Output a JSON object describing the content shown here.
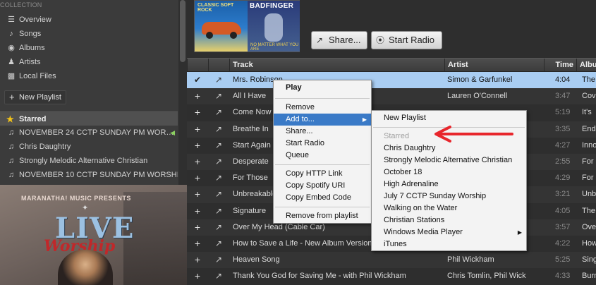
{
  "sidebar": {
    "section_title": "COLLECTION",
    "nav": [
      {
        "label": "Overview",
        "icon": "overview-icon"
      },
      {
        "label": "Songs",
        "icon": "music-note-icon"
      },
      {
        "label": "Albums",
        "icon": "album-icon"
      },
      {
        "label": "Artists",
        "icon": "artist-icon"
      },
      {
        "label": "Local Files",
        "icon": "local-files-icon"
      }
    ],
    "new_playlist": "New Playlist",
    "starred": "Starred",
    "playlists": [
      {
        "label": "NOVEMBER 24 CCTP SUNDAY PM WOR…",
        "playing": true
      },
      {
        "label": "Chris Daughtry",
        "playing": false
      },
      {
        "label": "Strongly Melodic Alternative Christian",
        "playing": false
      },
      {
        "label": "NOVEMBER 10 CCTP SUNDAY PM WORSHIP",
        "playing": false
      }
    ],
    "cover": {
      "top_text": "MARANATHA! MUSIC PRESENTS",
      "title_line1": "LIVE",
      "title_line2": "Worship"
    }
  },
  "header": {
    "album_art_1": {
      "top": "CLASSIC SOFT ROCK"
    },
    "album_art_2": {
      "top": "BADFINGER",
      "bottom": "NO MATTER WHAT YOU ARE"
    },
    "share_label": "Share...",
    "radio_label": "Start Radio"
  },
  "table": {
    "columns": {
      "track": "Track",
      "artist": "Artist",
      "time": "Time",
      "album": "Albu"
    },
    "rows": [
      {
        "track": "Mrs. Robinson",
        "artist": "Simon & Garfunkel",
        "time": "4:04",
        "album": "The",
        "selected": true
      },
      {
        "track": "All I Have",
        "artist": "Lauren O'Connell",
        "time": "3:47",
        "album": "Cov"
      },
      {
        "track": "Come Now",
        "artist": "",
        "time": "5:19",
        "album": "It's"
      },
      {
        "track": "Breathe In",
        "artist": "",
        "time": "3:35",
        "album": "End"
      },
      {
        "track": "Start Again",
        "artist": "",
        "time": "4:27",
        "album": "Inno"
      },
      {
        "track": "Desperate",
        "artist": "",
        "time": "2:55",
        "album": "For"
      },
      {
        "track": "For Those",
        "artist": "",
        "time": "4:29",
        "album": "For"
      },
      {
        "track": "Unbreakable",
        "artist": "",
        "time": "3:21",
        "album": "Unb"
      },
      {
        "track": "Signature",
        "artist": "",
        "time": "4:05",
        "album": "The"
      },
      {
        "track": "Over My Head (Cable Car)",
        "artist": "",
        "time": "3:57",
        "album": "Ove"
      },
      {
        "track": "How to Save a Life - New Album Version",
        "artist": "The Fray",
        "time": "4:22",
        "album": "How"
      },
      {
        "track": "Heaven Song",
        "artist": "Phil Wickham",
        "time": "5:25",
        "album": "Sing"
      },
      {
        "track": "Thank You God for Saving Me - with Phil Wickham",
        "artist": "Chris Tomlin, Phil Wick",
        "time": "4:33",
        "album": "Burn"
      }
    ]
  },
  "context_menu": {
    "play": "Play",
    "remove": "Remove",
    "add_to": "Add to...",
    "share": "Share...",
    "start_radio": "Start Radio",
    "queue": "Queue",
    "copy_http": "Copy HTTP Link",
    "copy_uri": "Copy Spotify URI",
    "copy_embed": "Copy Embed Code",
    "remove_from_playlist": "Remove from playlist"
  },
  "submenu": {
    "new_playlist": "New Playlist",
    "items": [
      {
        "label": "Starred",
        "disabled": true
      },
      {
        "label": "Chris Daughtry"
      },
      {
        "label": "Strongly Melodic Alternative Christian"
      },
      {
        "label": "October 18"
      },
      {
        "label": "High Adrenaline"
      },
      {
        "label": "July 7 CCTP Sunday Worship"
      },
      {
        "label": "Walking on the Water"
      },
      {
        "label": "Christian Stations"
      },
      {
        "label": "Windows Media Player",
        "has_submenu": true
      },
      {
        "label": "iTunes"
      }
    ]
  },
  "annotation": {
    "color": "#e8262c"
  },
  "colors": {
    "selection": "#a9cdf2",
    "menu_highlight": "#3a7ac7",
    "star": "#f5c518"
  }
}
